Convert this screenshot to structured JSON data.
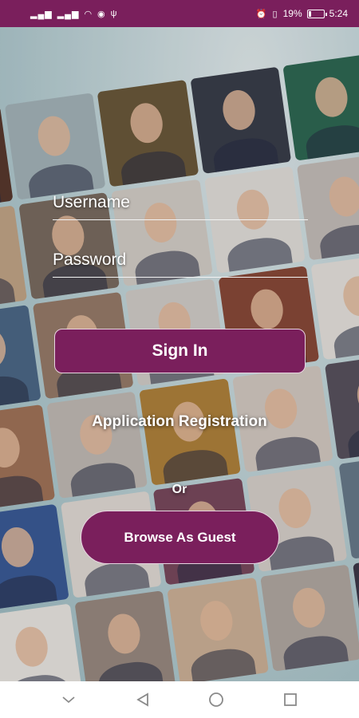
{
  "status_bar": {
    "left_icons": [
      "signal-icon",
      "signal-icon",
      "wifi-icon",
      "eye-icon",
      "usb-icon"
    ],
    "alarm_icon": "alarm-icon",
    "vibrate_icon": "vibrate-icon",
    "battery_percent": "19%",
    "battery_level": 0.19,
    "time": "5:24"
  },
  "login_form": {
    "username_placeholder": "Username",
    "password_placeholder": "Password",
    "sign_in_label": "Sign In"
  },
  "registration_label": "Application Registration",
  "or_label": "Or",
  "guest_button_label": "Browse As Guest",
  "colors": {
    "brand": "#7a1f5c",
    "text": "#ffffff",
    "nav_icon": "#8a8a8a"
  },
  "nav_bar": {
    "icons": [
      "chevron-down-icon",
      "back-triangle-icon",
      "home-circle-icon",
      "recents-square-icon"
    ]
  }
}
